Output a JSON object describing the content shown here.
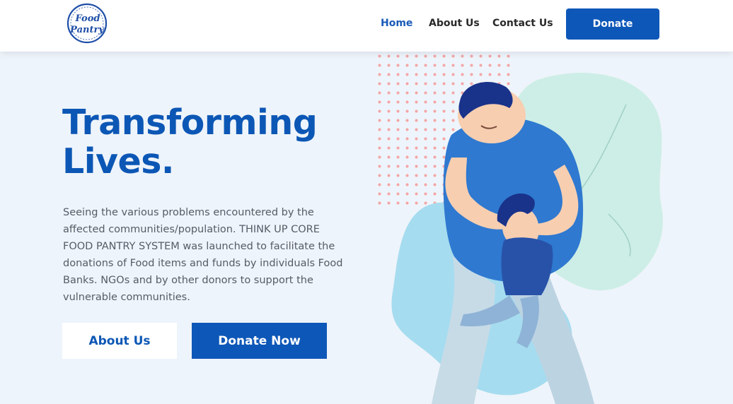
{
  "brand": {
    "logo_line1": "Food",
    "logo_line2": "Pantry"
  },
  "nav": {
    "items": [
      {
        "label": "Home",
        "active": true
      },
      {
        "label": "About Us",
        "active": false
      },
      {
        "label": "Contact Us",
        "active": false
      }
    ],
    "donate_label": "Donate"
  },
  "hero": {
    "title_line1": "Transforming",
    "title_line2": "Lives.",
    "description": "Seeing the various problems encountered by the affected communities/population. THINK UP CORE FOOD PANTRY SYSTEM was launched to facilitate the donations of Food items and funds by individuals Food Banks. NGOs and by other donors to support the vulnerable communities.",
    "about_button": "About Us",
    "donate_button": "Donate Now"
  },
  "colors": {
    "primary": "#0d57b8",
    "background": "#eef4fb",
    "dots": "#f4a6a6",
    "blob_mint": "#cdeee6",
    "blob_sky": "#a6dcef"
  },
  "icons": {
    "logo": "food-pantry-logo",
    "hero_art": "father-hugging-child-illustration"
  }
}
